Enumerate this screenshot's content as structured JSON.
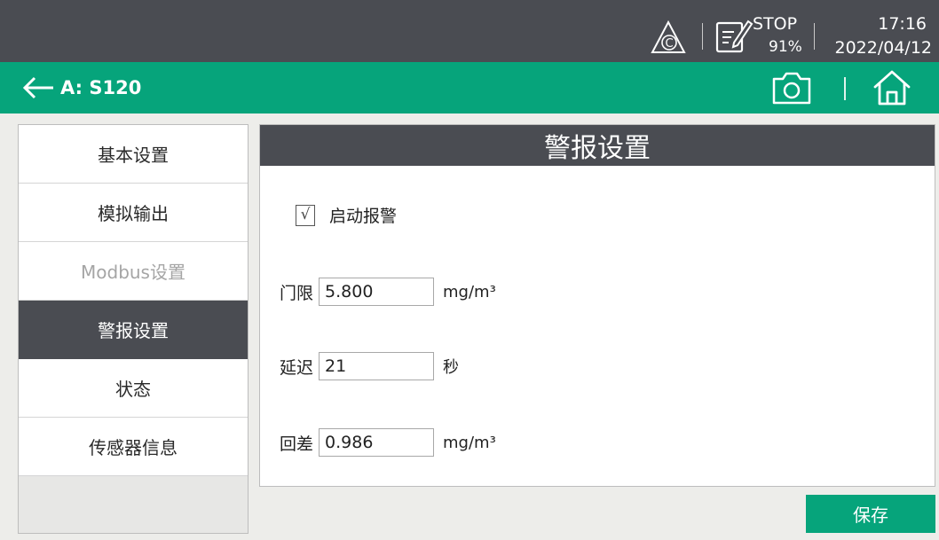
{
  "status_bar": {
    "icons": [
      "warning-c-icon",
      "edit-document-icon"
    ],
    "run_state": "STOP",
    "battery": "91%",
    "time": "17:16",
    "date": "2022/04/12"
  },
  "title_bar": {
    "device": "A: S120",
    "icons": [
      "back-arrow-icon",
      "camera-icon",
      "home-icon"
    ]
  },
  "sidebar": {
    "items": [
      {
        "label": "基本设置",
        "state": "normal"
      },
      {
        "label": "模拟输出",
        "state": "normal"
      },
      {
        "label": "Modbus设置",
        "state": "disabled"
      },
      {
        "label": "警报设置",
        "state": "active"
      },
      {
        "label": "状态",
        "state": "normal"
      },
      {
        "label": "传感器信息",
        "state": "normal"
      }
    ]
  },
  "panel": {
    "title": "警报设置",
    "enable_alarm": {
      "mark": "√",
      "checked": true,
      "label": "启动报警"
    },
    "fields": [
      {
        "label": "门限",
        "value": "5.800",
        "unit": "mg/m³"
      },
      {
        "label": "延迟",
        "value": "21",
        "unit": "秒"
      },
      {
        "label": "回差",
        "value": "0.986",
        "unit": "mg/m³"
      }
    ]
  },
  "save_label": "保存",
  "colors": {
    "dark_bar": "#4a4c52",
    "accent_green": "#06a47b",
    "background": "#ededea"
  }
}
